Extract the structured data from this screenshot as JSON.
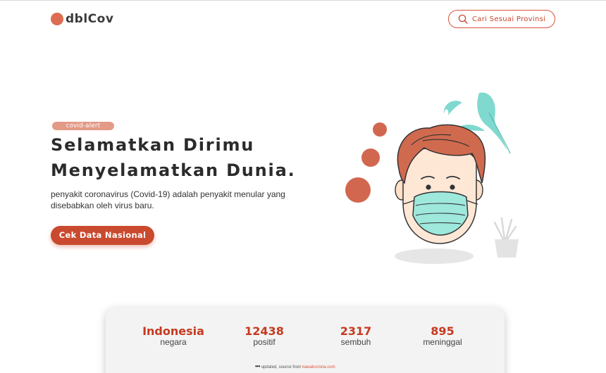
{
  "navbar": {
    "brand": "dblCov",
    "search_label": "Cari Sesuai Provinsi",
    "accent_color": "#d9543a"
  },
  "hero": {
    "tag": "covid-alert",
    "headline_line1": "Selamatkan Dirimu",
    "headline_line2": "Menyelamatkan Dunia.",
    "description": "penyakit coronavirus (Covid-19) adalah penyakit menular yang disebabkan oleh virus baru.",
    "cta_label": "Cek Data Nasional",
    "illustration_icon": "masked-person-illustration"
  },
  "stats": {
    "country": {
      "value": "Indonesia",
      "label": "negara"
    },
    "positive": {
      "value": "12438",
      "label": "positif"
    },
    "recovered": {
      "value": "2317",
      "label": "sembuh"
    },
    "deaths": {
      "value": "895",
      "label": "meninggal"
    },
    "source_prefix": "updated, source from",
    "source_link": "kawalcorona.com"
  }
}
